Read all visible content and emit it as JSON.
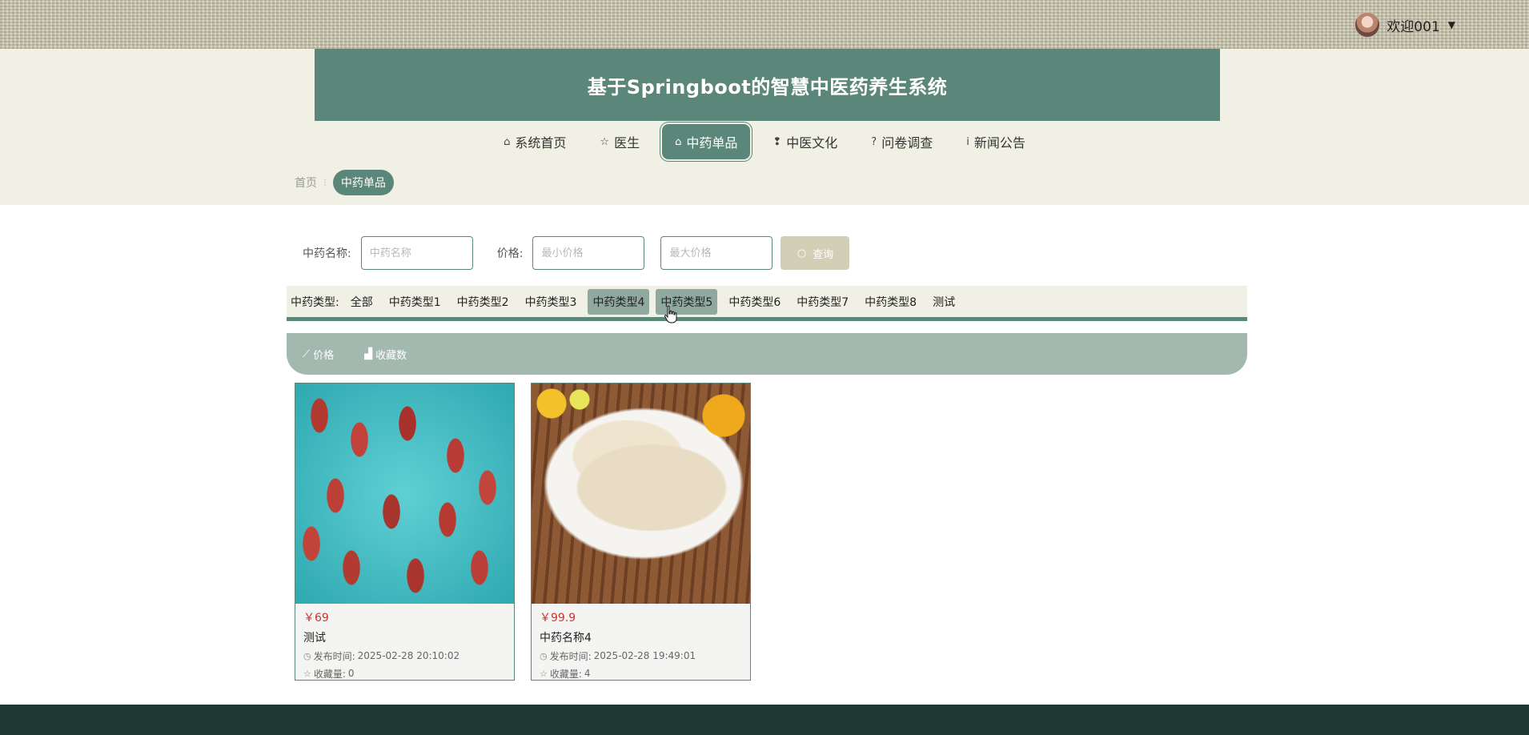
{
  "user": {
    "greeting": "欢迎001"
  },
  "header": {
    "title": "基于Springboot的智慧中医药养生系统"
  },
  "nav": {
    "items": [
      {
        "label": "系统首页",
        "icon": "home-icon",
        "glyph": "⌂"
      },
      {
        "label": "医生",
        "icon": "star-icon",
        "glyph": "☆"
      },
      {
        "label": "中药单品",
        "icon": "bag-icon",
        "glyph": "⌂"
      },
      {
        "label": "中医文化",
        "icon": "info-circle-icon",
        "glyph": "❢"
      },
      {
        "label": "问卷调查",
        "icon": "question-circle-icon",
        "glyph": "?"
      },
      {
        "label": "新闻公告",
        "icon": "info-icon",
        "glyph": "i"
      }
    ],
    "active_index": 2
  },
  "breadcrumb": {
    "home": "首页",
    "separator": "⁝",
    "current": "中药单品"
  },
  "search": {
    "name_label": "中药名称:",
    "name_placeholder": "中药名称",
    "price_label": "价格:",
    "min_placeholder": "最小价格",
    "max_placeholder": "最大价格",
    "button_label": "查询"
  },
  "types": {
    "label": "中药类型:",
    "items": [
      "全部",
      "中药类型1",
      "中药类型2",
      "中药类型3",
      "中药类型4",
      "中药类型5",
      "中药类型6",
      "中药类型7",
      "中药类型8",
      "测试"
    ],
    "highlighted": [
      "中药类型4",
      "中药类型5"
    ]
  },
  "sort": {
    "price_label": "价格",
    "fav_label": "收藏数"
  },
  "products": [
    {
      "price": "￥69",
      "name": "测试",
      "publish_label": "发布时间:",
      "publish_time": "2025-02-28 20:10:02",
      "fav_label": "收藏量:",
      "fav_count": "0"
    },
    {
      "price": "￥99.9",
      "name": "中药名称4",
      "publish_label": "发布时间:",
      "publish_time": "2025-02-28 19:49:01",
      "fav_label": "收藏量:",
      "fav_count": "4"
    }
  ],
  "colors": {
    "primary": "#5b877a",
    "header_bg": "#f1f0e4",
    "sort_bar": "#a3b9b0",
    "price": "#d0322c",
    "footer": "#1f3a33",
    "search_button": "#d3cfb6"
  }
}
